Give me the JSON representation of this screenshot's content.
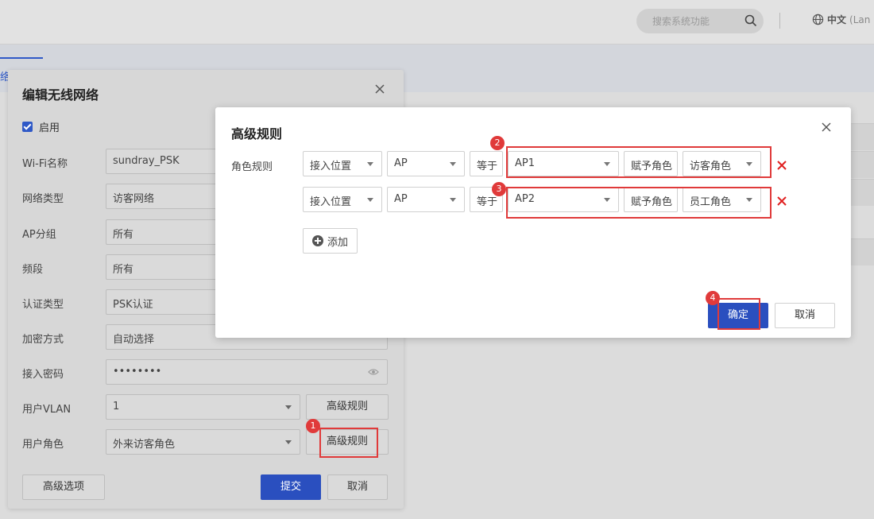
{
  "header": {
    "search_placeholder": "搜索系统功能",
    "language": "中文",
    "language_extra": "(Lan"
  },
  "tabs": {
    "active_fragment": "络"
  },
  "edit_dialog": {
    "title": "编辑无线网络",
    "enable_label": "启用",
    "enabled": true,
    "fields": {
      "wifi_name": {
        "label": "Wi-Fi名称",
        "value": "sundray_PSK"
      },
      "network_type": {
        "label": "网络类型",
        "value": "访客网络"
      },
      "ap_group": {
        "label": "AP分组",
        "value": "所有"
      },
      "band": {
        "label": "频段",
        "value": "所有"
      },
      "auth_type": {
        "label": "认证类型",
        "value": "PSK认证"
      },
      "encryption": {
        "label": "加密方式",
        "value": "自动选择"
      },
      "password": {
        "label": "接入密码",
        "value": "••••••••"
      },
      "user_vlan": {
        "label": "用户VLAN",
        "value": "1",
        "button": "高级规则"
      },
      "user_role": {
        "label": "用户角色",
        "value": "外来访客角色",
        "button": "高级规则"
      }
    },
    "advanced_options": "高级选项",
    "submit": "提交",
    "cancel": "取消"
  },
  "advanced_dialog": {
    "title": "高级规则",
    "role_rule_label": "角色规则",
    "rules": [
      {
        "access": "接入位置",
        "type": "AP",
        "operator": "等于",
        "target": "AP1",
        "assign": "赋予角色",
        "role": "访客角色"
      },
      {
        "access": "接入位置",
        "type": "AP",
        "operator": "等于",
        "target": "AP2",
        "assign": "赋予角色",
        "role": "员工角色"
      }
    ],
    "add": "添加",
    "confirm": "确定",
    "cancel": "取消"
  },
  "annotations": [
    "1",
    "2",
    "3",
    "4"
  ],
  "colors": {
    "primary": "#2a4fbf",
    "annotation": "#e03a3a",
    "delete": "#e02020"
  }
}
